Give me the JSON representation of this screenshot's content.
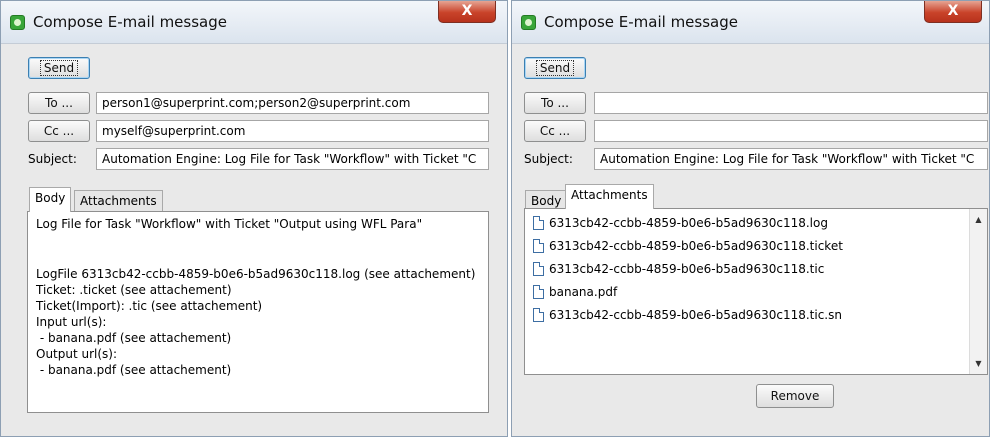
{
  "left_window": {
    "title": "Compose E-mail message",
    "close_label": "X",
    "send_label": "Send",
    "to_label": "To ...",
    "to_value": "person1@superprint.com;person2@superprint.com",
    "cc_label": "Cc ...",
    "cc_value": "myself@superprint.com",
    "subject_label": "Subject:",
    "subject_value": "Automation Engine: Log File for Task \"Workflow\" with Ticket \"C",
    "tabs": [
      {
        "label": "Body",
        "active": true
      },
      {
        "label": "Attachments",
        "active": false
      }
    ],
    "body_lines": [
      "Log File for Task \"Workflow\" with Ticket \"Output using WFL Para\"",
      "",
      "",
      "LogFile 6313cb42-ccbb-4859-b0e6-b5ad9630c118.log (see attachement)",
      "Ticket: .ticket (see attachement)",
      "Ticket(Import): .tic (see attachement)",
      "Input url(s):",
      " - banana.pdf (see attachement)",
      "Output url(s):",
      " - banana.pdf (see attachement)"
    ]
  },
  "right_window": {
    "title": "Compose E-mail message",
    "close_label": "X",
    "send_label": "Send",
    "to_label": "To ...",
    "to_value": "",
    "cc_label": "Cc ...",
    "cc_value": "",
    "subject_label": "Subject:",
    "subject_value": "Automation Engine: Log File for Task \"Workflow\" with Ticket \"C",
    "tabs": [
      {
        "label": "Body",
        "active": false
      },
      {
        "label": "Attachments",
        "active": true
      }
    ],
    "attachments": [
      "6313cb42-ccbb-4859-b0e6-b5ad9630c118.log",
      "6313cb42-ccbb-4859-b0e6-b5ad9630c118.ticket",
      "6313cb42-ccbb-4859-b0e6-b5ad9630c118.tic",
      "banana.pdf",
      "6313cb42-ccbb-4859-b0e6-b5ad9630c118.tic.sn"
    ],
    "remove_label": "Remove"
  }
}
